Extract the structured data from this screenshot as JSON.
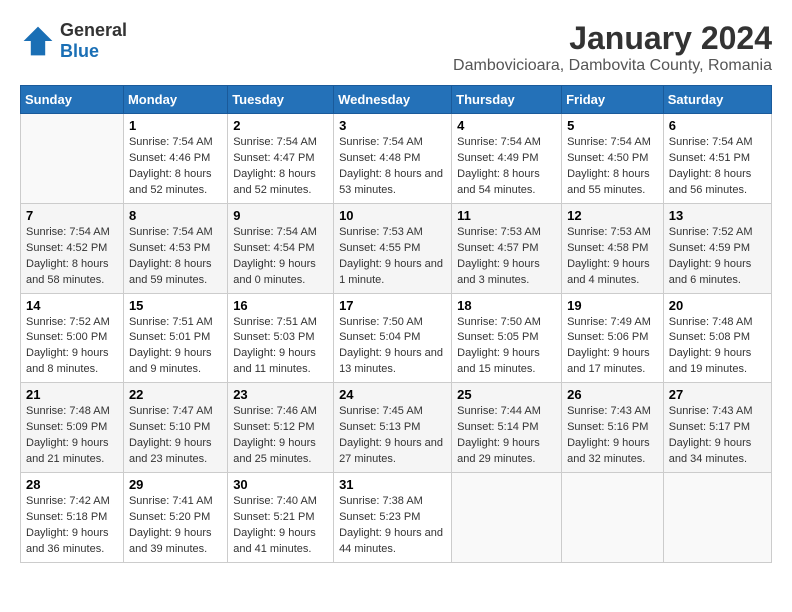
{
  "header": {
    "logo_general": "General",
    "logo_blue": "Blue",
    "month": "January 2024",
    "location": "Dambovicioara, Dambovita County, Romania"
  },
  "weekdays": [
    "Sunday",
    "Monday",
    "Tuesday",
    "Wednesday",
    "Thursday",
    "Friday",
    "Saturday"
  ],
  "weeks": [
    [
      {
        "day": "",
        "sunrise": "",
        "sunset": "",
        "daylight": ""
      },
      {
        "day": "1",
        "sunrise": "Sunrise: 7:54 AM",
        "sunset": "Sunset: 4:46 PM",
        "daylight": "Daylight: 8 hours and 52 minutes."
      },
      {
        "day": "2",
        "sunrise": "Sunrise: 7:54 AM",
        "sunset": "Sunset: 4:47 PM",
        "daylight": "Daylight: 8 hours and 52 minutes."
      },
      {
        "day": "3",
        "sunrise": "Sunrise: 7:54 AM",
        "sunset": "Sunset: 4:48 PM",
        "daylight": "Daylight: 8 hours and 53 minutes."
      },
      {
        "day": "4",
        "sunrise": "Sunrise: 7:54 AM",
        "sunset": "Sunset: 4:49 PM",
        "daylight": "Daylight: 8 hours and 54 minutes."
      },
      {
        "day": "5",
        "sunrise": "Sunrise: 7:54 AM",
        "sunset": "Sunset: 4:50 PM",
        "daylight": "Daylight: 8 hours and 55 minutes."
      },
      {
        "day": "6",
        "sunrise": "Sunrise: 7:54 AM",
        "sunset": "Sunset: 4:51 PM",
        "daylight": "Daylight: 8 hours and 56 minutes."
      }
    ],
    [
      {
        "day": "7",
        "sunrise": "Sunrise: 7:54 AM",
        "sunset": "Sunset: 4:52 PM",
        "daylight": "Daylight: 8 hours and 58 minutes."
      },
      {
        "day": "8",
        "sunrise": "Sunrise: 7:54 AM",
        "sunset": "Sunset: 4:53 PM",
        "daylight": "Daylight: 8 hours and 59 minutes."
      },
      {
        "day": "9",
        "sunrise": "Sunrise: 7:54 AM",
        "sunset": "Sunset: 4:54 PM",
        "daylight": "Daylight: 9 hours and 0 minutes."
      },
      {
        "day": "10",
        "sunrise": "Sunrise: 7:53 AM",
        "sunset": "Sunset: 4:55 PM",
        "daylight": "Daylight: 9 hours and 1 minute."
      },
      {
        "day": "11",
        "sunrise": "Sunrise: 7:53 AM",
        "sunset": "Sunset: 4:57 PM",
        "daylight": "Daylight: 9 hours and 3 minutes."
      },
      {
        "day": "12",
        "sunrise": "Sunrise: 7:53 AM",
        "sunset": "Sunset: 4:58 PM",
        "daylight": "Daylight: 9 hours and 4 minutes."
      },
      {
        "day": "13",
        "sunrise": "Sunrise: 7:52 AM",
        "sunset": "Sunset: 4:59 PM",
        "daylight": "Daylight: 9 hours and 6 minutes."
      }
    ],
    [
      {
        "day": "14",
        "sunrise": "Sunrise: 7:52 AM",
        "sunset": "Sunset: 5:00 PM",
        "daylight": "Daylight: 9 hours and 8 minutes."
      },
      {
        "day": "15",
        "sunrise": "Sunrise: 7:51 AM",
        "sunset": "Sunset: 5:01 PM",
        "daylight": "Daylight: 9 hours and 9 minutes."
      },
      {
        "day": "16",
        "sunrise": "Sunrise: 7:51 AM",
        "sunset": "Sunset: 5:03 PM",
        "daylight": "Daylight: 9 hours and 11 minutes."
      },
      {
        "day": "17",
        "sunrise": "Sunrise: 7:50 AM",
        "sunset": "Sunset: 5:04 PM",
        "daylight": "Daylight: 9 hours and 13 minutes."
      },
      {
        "day": "18",
        "sunrise": "Sunrise: 7:50 AM",
        "sunset": "Sunset: 5:05 PM",
        "daylight": "Daylight: 9 hours and 15 minutes."
      },
      {
        "day": "19",
        "sunrise": "Sunrise: 7:49 AM",
        "sunset": "Sunset: 5:06 PM",
        "daylight": "Daylight: 9 hours and 17 minutes."
      },
      {
        "day": "20",
        "sunrise": "Sunrise: 7:48 AM",
        "sunset": "Sunset: 5:08 PM",
        "daylight": "Daylight: 9 hours and 19 minutes."
      }
    ],
    [
      {
        "day": "21",
        "sunrise": "Sunrise: 7:48 AM",
        "sunset": "Sunset: 5:09 PM",
        "daylight": "Daylight: 9 hours and 21 minutes."
      },
      {
        "day": "22",
        "sunrise": "Sunrise: 7:47 AM",
        "sunset": "Sunset: 5:10 PM",
        "daylight": "Daylight: 9 hours and 23 minutes."
      },
      {
        "day": "23",
        "sunrise": "Sunrise: 7:46 AM",
        "sunset": "Sunset: 5:12 PM",
        "daylight": "Daylight: 9 hours and 25 minutes."
      },
      {
        "day": "24",
        "sunrise": "Sunrise: 7:45 AM",
        "sunset": "Sunset: 5:13 PM",
        "daylight": "Daylight: 9 hours and 27 minutes."
      },
      {
        "day": "25",
        "sunrise": "Sunrise: 7:44 AM",
        "sunset": "Sunset: 5:14 PM",
        "daylight": "Daylight: 9 hours and 29 minutes."
      },
      {
        "day": "26",
        "sunrise": "Sunrise: 7:43 AM",
        "sunset": "Sunset: 5:16 PM",
        "daylight": "Daylight: 9 hours and 32 minutes."
      },
      {
        "day": "27",
        "sunrise": "Sunrise: 7:43 AM",
        "sunset": "Sunset: 5:17 PM",
        "daylight": "Daylight: 9 hours and 34 minutes."
      }
    ],
    [
      {
        "day": "28",
        "sunrise": "Sunrise: 7:42 AM",
        "sunset": "Sunset: 5:18 PM",
        "daylight": "Daylight: 9 hours and 36 minutes."
      },
      {
        "day": "29",
        "sunrise": "Sunrise: 7:41 AM",
        "sunset": "Sunset: 5:20 PM",
        "daylight": "Daylight: 9 hours and 39 minutes."
      },
      {
        "day": "30",
        "sunrise": "Sunrise: 7:40 AM",
        "sunset": "Sunset: 5:21 PM",
        "daylight": "Daylight: 9 hours and 41 minutes."
      },
      {
        "day": "31",
        "sunrise": "Sunrise: 7:38 AM",
        "sunset": "Sunset: 5:23 PM",
        "daylight": "Daylight: 9 hours and 44 minutes."
      },
      {
        "day": "",
        "sunrise": "",
        "sunset": "",
        "daylight": ""
      },
      {
        "day": "",
        "sunrise": "",
        "sunset": "",
        "daylight": ""
      },
      {
        "day": "",
        "sunrise": "",
        "sunset": "",
        "daylight": ""
      }
    ]
  ]
}
